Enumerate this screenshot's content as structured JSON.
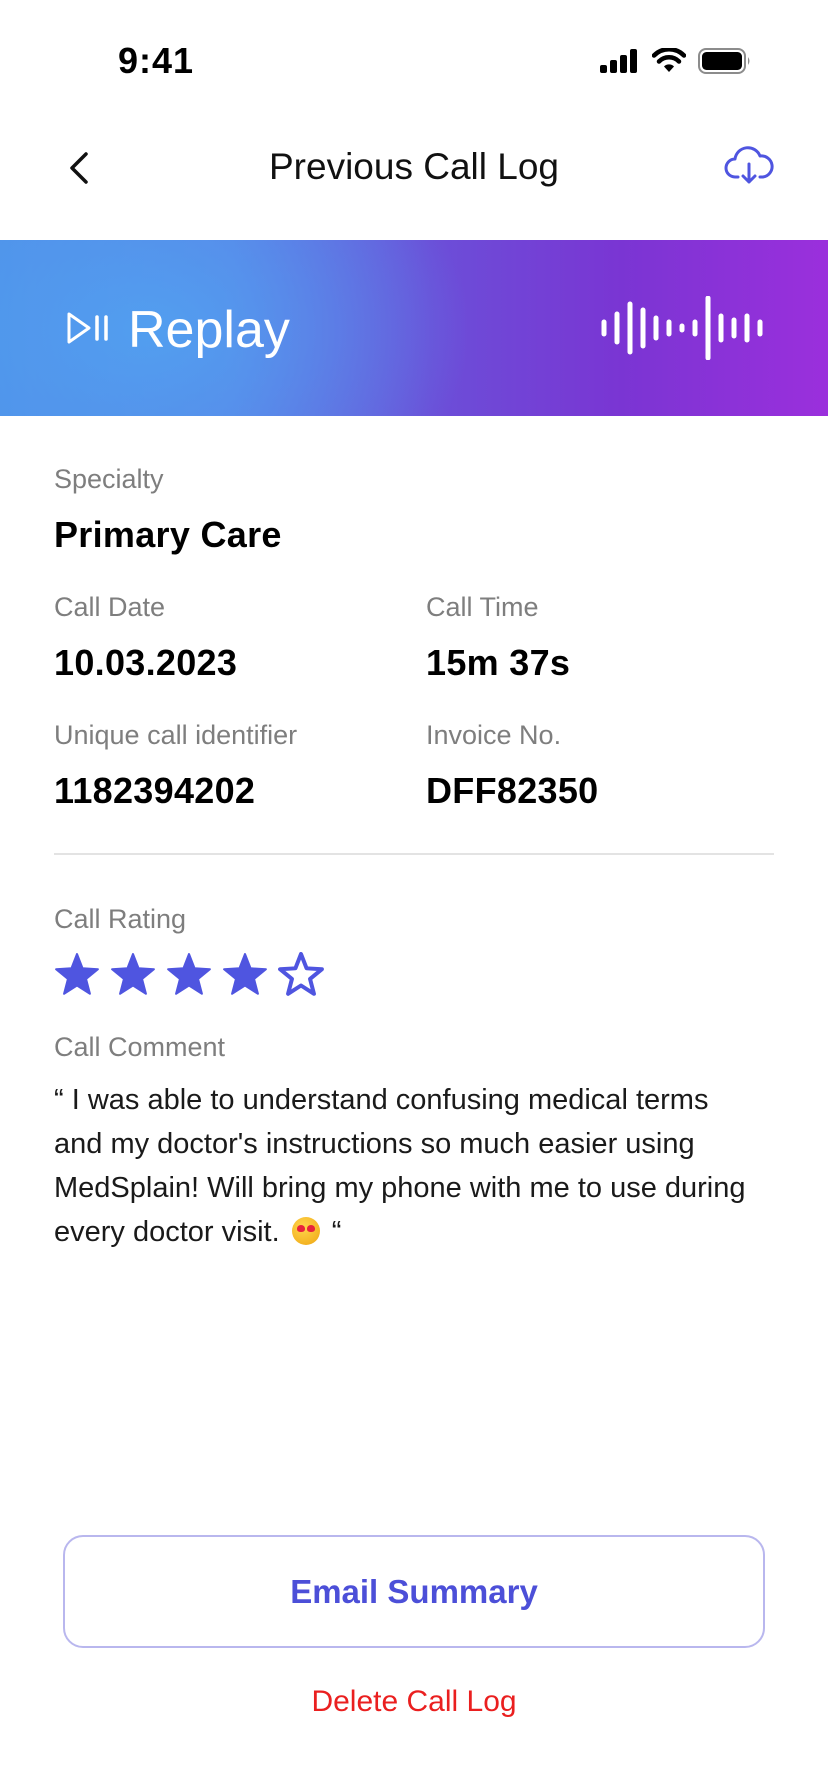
{
  "status_bar": {
    "time": "9:41",
    "icons": [
      "cellular-signal-icon",
      "wifi-icon",
      "battery-icon"
    ]
  },
  "header": {
    "title": "Previous Call Log",
    "back_icon": "chevron-left-icon",
    "download_icon": "cloud-download-icon"
  },
  "replay": {
    "label": "Replay",
    "icon": "play-pause-icon",
    "waveform_icon": "audio-waveform-icon"
  },
  "details": {
    "specialty": {
      "label": "Specialty",
      "value": "Primary Care"
    },
    "call_date": {
      "label": "Call Date",
      "value": "10.03.2023"
    },
    "call_time": {
      "label": "Call Time",
      "value": "15m 37s"
    },
    "call_id": {
      "label": "Unique call identifier",
      "value": "1182394202"
    },
    "invoice": {
      "label": "Invoice No.",
      "value": "DFF82350"
    }
  },
  "rating": {
    "label": "Call Rating",
    "value": 4,
    "max": 5
  },
  "comment": {
    "label": "Call Comment",
    "text_before": "“ I was able to understand confusing medical terms and my doctor's instructions so much easier using MedSplain! Will bring my phone with me to use during every doctor visit.",
    "emoji": "heart-eyes-emoji",
    "text_after": "“"
  },
  "actions": {
    "email_summary": "Email Summary",
    "delete_call_log": "Delete Call Log"
  },
  "colors": {
    "accent": "#4c4fd8",
    "star": "#4f55e0",
    "danger": "#ea1f1f",
    "banner_start": "#4f8fe8",
    "banner_end": "#9b2fdc"
  }
}
